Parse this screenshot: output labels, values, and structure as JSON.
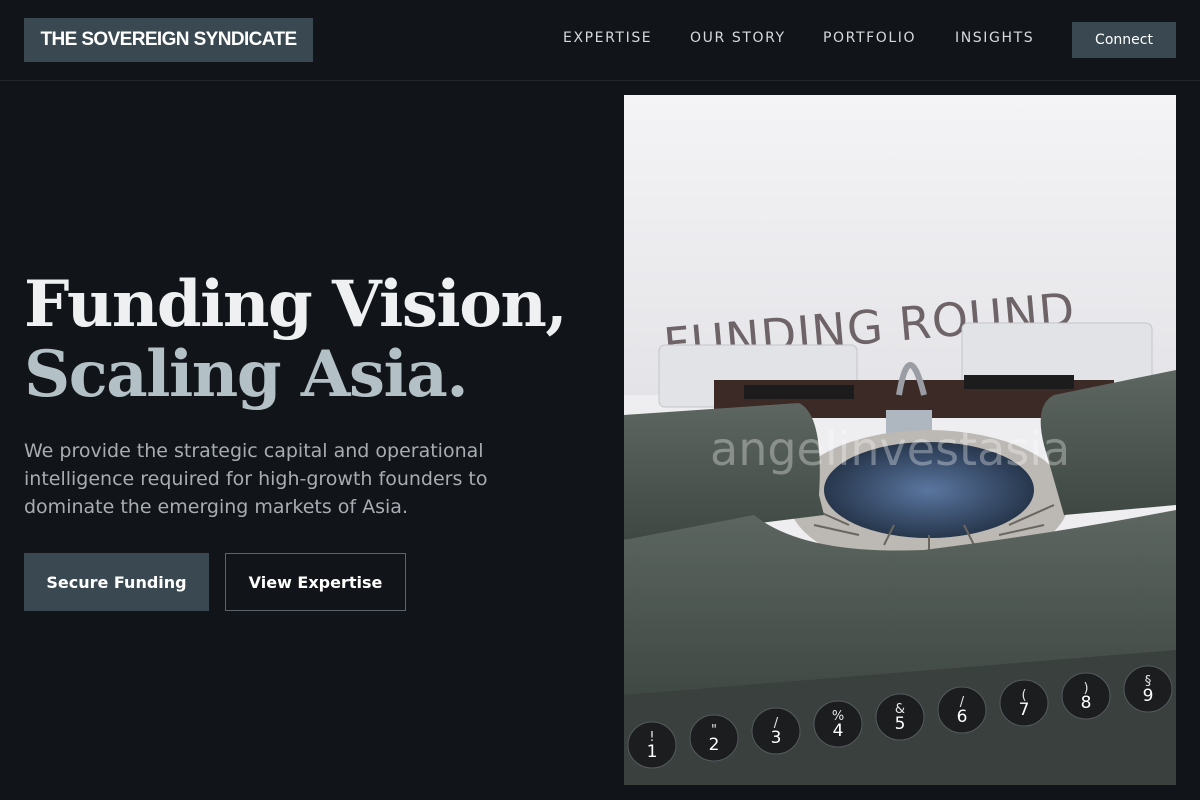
{
  "brand": {
    "name": "THE SOVEREIGN SYNDICATE"
  },
  "nav": {
    "items": [
      {
        "label": "EXPERTISE"
      },
      {
        "label": "OUR STORY"
      },
      {
        "label": "PORTFOLIO"
      },
      {
        "label": "INSIGHTS"
      }
    ],
    "cta_label": "Connect"
  },
  "hero": {
    "headline_line1": "Funding Vision,",
    "headline_line2": "Scaling Asia.",
    "subtext": "We provide the strategic capital and operational intelligence required for high-growth founders to dominate the emerging markets of Asia.",
    "primary_button": "Secure Funding",
    "secondary_button": "View Expertise"
  },
  "image": {
    "paper_text": "FUNDING ROUND",
    "watermark": "angelinvestasia",
    "key_labels": [
      "1",
      "2",
      "3",
      "4",
      "5",
      "6",
      "7",
      "8",
      "9"
    ],
    "key_shift_labels": [
      "!",
      "\"",
      "/",
      "%",
      "&",
      "/",
      "(",
      ")",
      "§"
    ]
  },
  "colors": {
    "background": "#111418",
    "accent": "#3a4951",
    "headline_primary": "#eef0f2",
    "headline_secondary": "#b3c0c6",
    "body_text": "#a7adb3"
  }
}
